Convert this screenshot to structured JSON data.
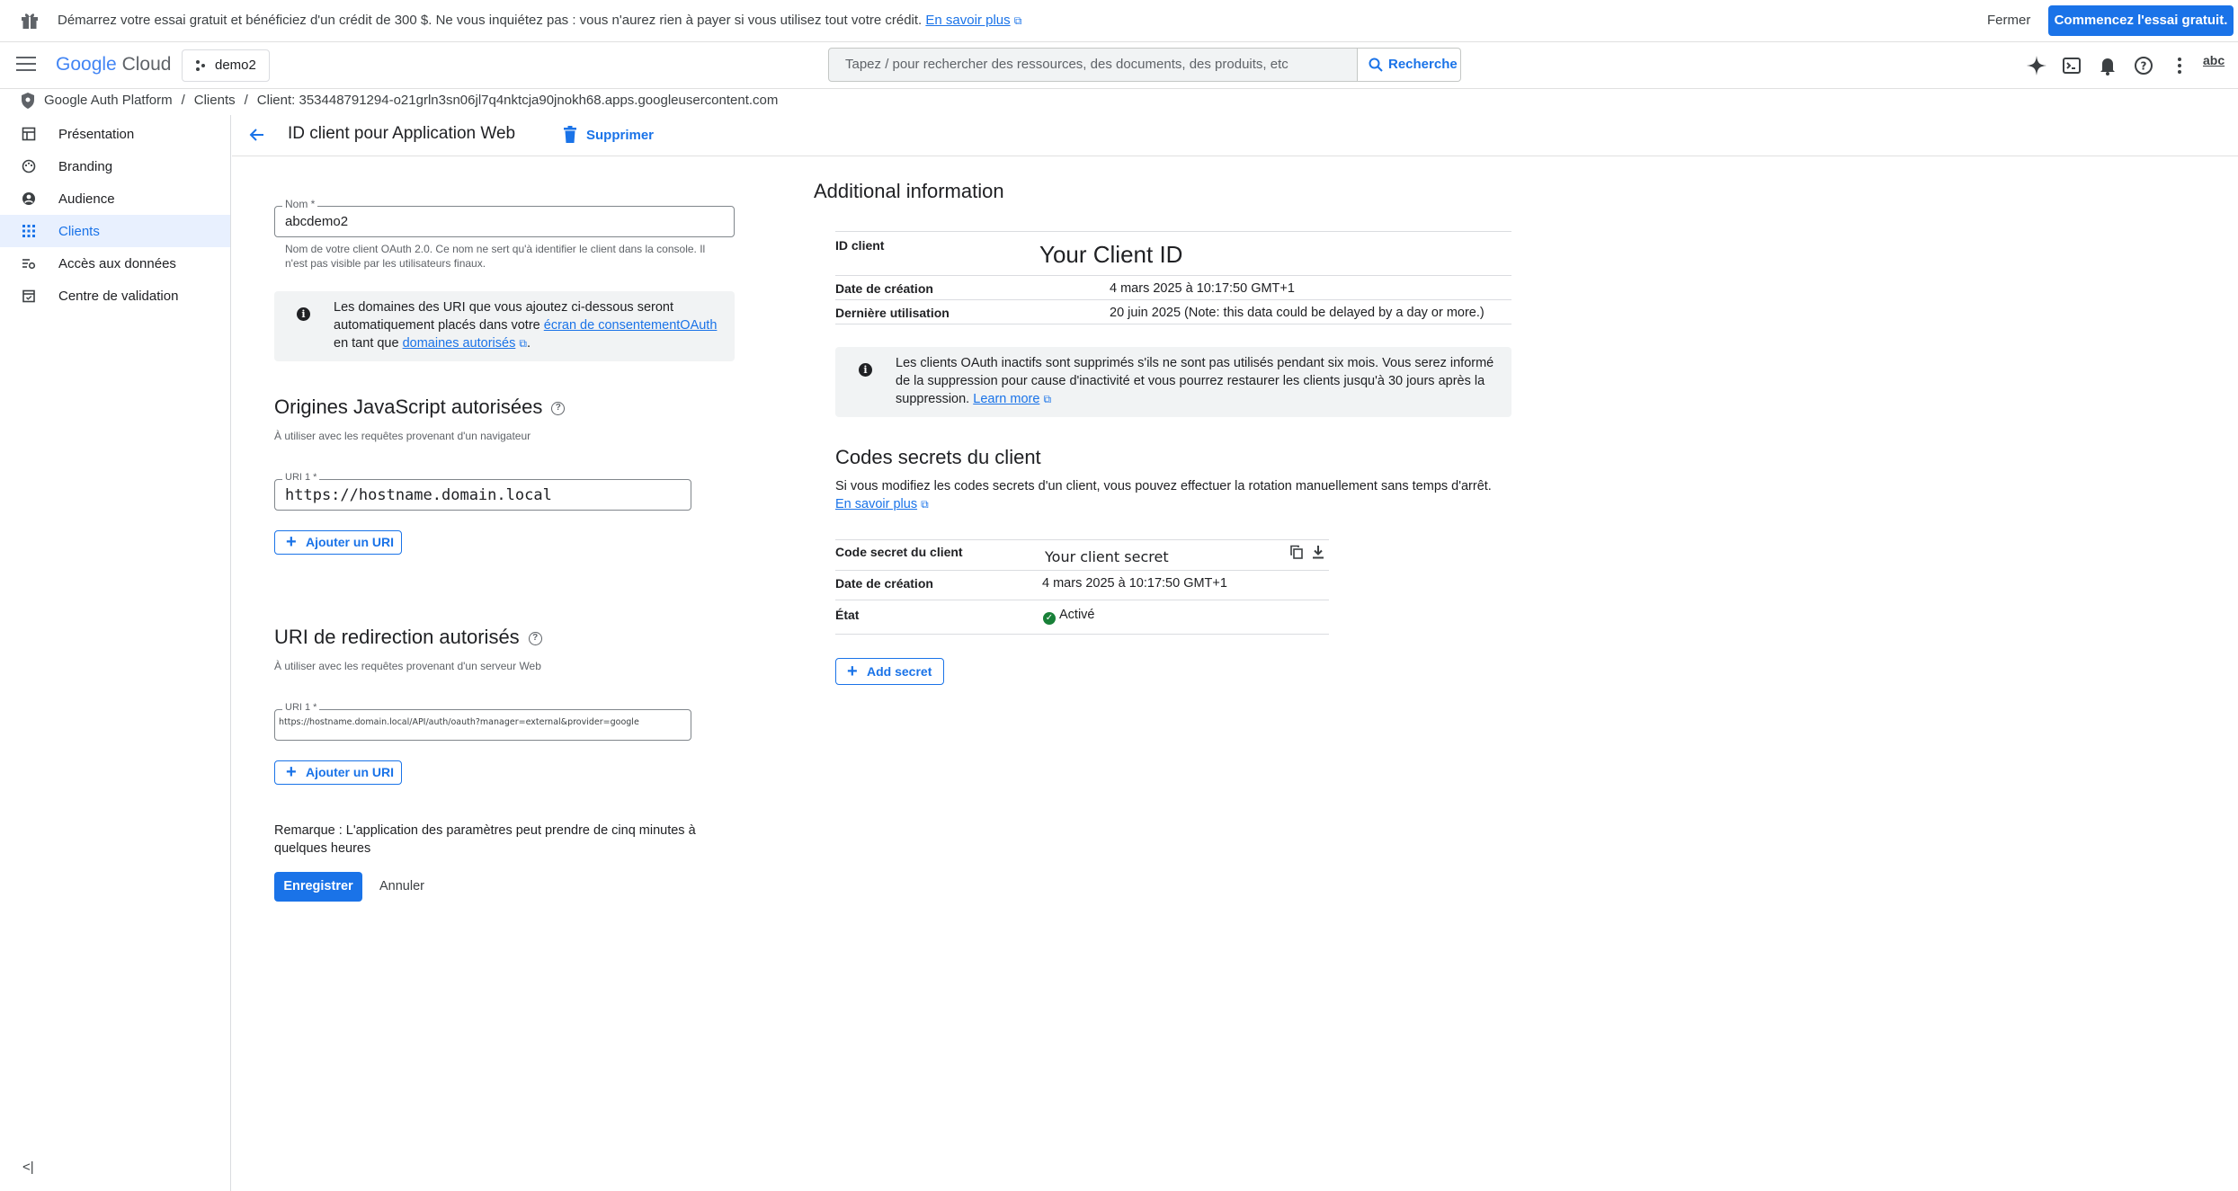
{
  "promo": {
    "message": "Démarrez votre essai gratuit et bénéficiez d'un crédit de 300 $. Ne vous inquiétez pas : vous n'aurez rien à payer si vous utilisez tout votre crédit.",
    "learn_more": "En savoir plus",
    "close_label": "Fermer",
    "start_label": "Commencez l'essai gratuit."
  },
  "topbar": {
    "logo_google": "Google",
    "logo_cloud": "Cloud",
    "project": "demo2",
    "search_placeholder": "Tapez / pour rechercher des ressources, des documents, des produits, etc",
    "search_button": "Recherche",
    "avatar_text": "abc"
  },
  "breadcrumb": {
    "items": [
      "Google Auth Platform",
      "Clients",
      "Client: 353448791294-o21grln3sn06jl7q4nktcja90jnokh68.apps.googleusercontent.com"
    ]
  },
  "sidebar": {
    "items": [
      {
        "label": "Présentation",
        "icon": "dashboard-icon"
      },
      {
        "label": "Branding",
        "icon": "palette-icon"
      },
      {
        "label": "Audience",
        "icon": "person-icon"
      },
      {
        "label": "Clients",
        "icon": "apps-grid-icon"
      },
      {
        "label": "Accès aux données",
        "icon": "data-access-icon"
      },
      {
        "label": "Centre de validation",
        "icon": "calendar-check-icon"
      }
    ],
    "active": "Clients",
    "collapse": "<|"
  },
  "page": {
    "title": "ID client pour Application Web",
    "delete_label": "Supprimer"
  },
  "form": {
    "name_label": "Nom *",
    "name_value": "abcdemo2",
    "name_help": "Nom de votre client OAuth 2.0. Ce nom ne sert qu'à identifier le client dans la console. Il n'est pas visible par les utilisateurs finaux.",
    "info": {
      "before": "Les domaines des URI que vous ajoutez ci-dessous seront automatiquement placés dans votre ",
      "link1": "écran de consentementOAuth",
      "middle": " en tant que ",
      "link2": "domaines autorisés",
      "after": "."
    },
    "js_origins": {
      "title": "Origines JavaScript autorisées",
      "subtitle": "À utiliser avec les requêtes provenant d'un navigateur",
      "uri_label": "URI 1 *",
      "uri_value": "https://hostname.domain.local",
      "add_label": "Ajouter un URI"
    },
    "redirect": {
      "title": "URI de redirection autorisés",
      "subtitle": "À utiliser avec les requêtes provenant d'un serveur Web",
      "uri_label": "URI 1 *",
      "uri_value": "https://hostname.domain.local/API/auth/oauth?manager=external&provider=google",
      "add_label": "Ajouter un URI"
    },
    "note": "Remarque : L'application des paramètres peut prendre de cinq minutes à quelques heures",
    "save_label": "Enregistrer",
    "cancel_label": "Annuler"
  },
  "additional": {
    "title": "Additional information",
    "client_id_key": "ID client",
    "client_id_value": "Your Client ID",
    "created_key": "Date de création",
    "created_value": "4 mars 2025 à 10:17:50 GMT+1",
    "last_used_key": "Dernière utilisation",
    "last_used_value": "20 juin 2025 (Note: this data could be delayed by a day or more.)",
    "info": {
      "text": "Les clients OAuth inactifs sont supprimés s'ils ne sont pas utilisés pendant six mois. Vous serez informé de la suppression pour cause d'inactivité et vous pourrez restaurer les clients jusqu'à 30 jours après la suppression. ",
      "link": "Learn more"
    }
  },
  "secrets": {
    "title": "Codes secrets du client",
    "desc": "Si vous modifiez les codes secrets d'un client, vous pouvez effectuer la rotation manuellement sans temps d'arrêt. ",
    "desc_link": "En savoir plus",
    "secret_key": "Code secret du client",
    "secret_value": "Your client secret",
    "created_key": "Date de création",
    "created_value": "4 mars 2025 à 10:17:50 GMT+1",
    "state_key": "État",
    "state_value": "Activé",
    "add_label": "Add secret"
  },
  "colors": {
    "accent": "#1a73e8",
    "active_bg": "#e8f0fe",
    "success": "#188038"
  }
}
